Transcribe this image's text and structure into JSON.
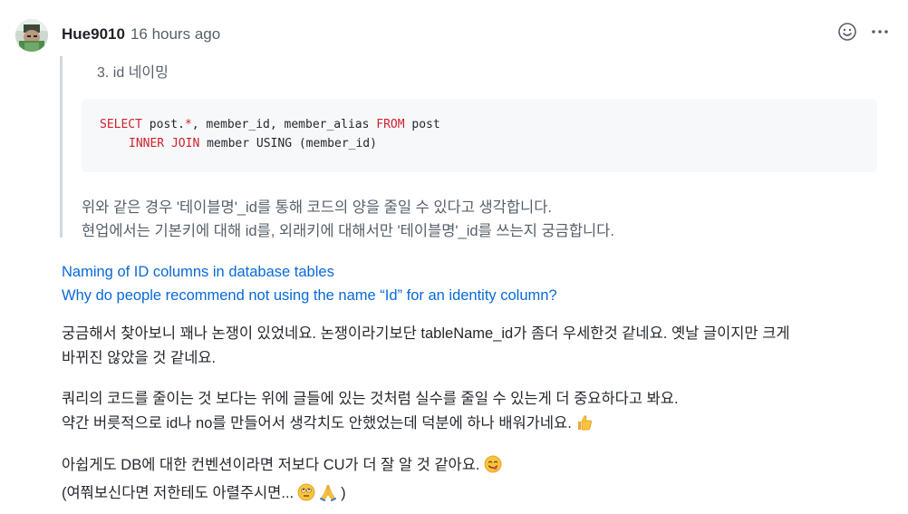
{
  "comment": {
    "author": "Hue9010",
    "timestamp": "16 hours ago",
    "quote": {
      "heading": "3. id 네이밍",
      "code": {
        "line1": {
          "kw1": "SELECT",
          "text1": " post.",
          "star": "*",
          "text2": ", member_id, member_alias ",
          "kw2": "FROM",
          "text3": " post"
        },
        "line2": {
          "kw1": "INNER",
          "sp": " ",
          "kw2": "JOIN",
          "text1": " member USING (member_id)"
        }
      },
      "text_line1": "위와 같은 경우 '테이블명'_id를 통해 코드의 양을 줄일 수 있다고 생각합니다.",
      "text_line2": "현업에서는 기본키에 대해 id를, 외래키에 대해서만 '테이블명'_id를 쓰는지 궁금합니다."
    },
    "links": [
      "Naming of ID columns in database tables",
      "Why do people recommend not using the name “Id” for an identity column?"
    ],
    "paragraphs": {
      "p1_line1": "궁금해서 찾아보니 꽤나 논쟁이 있었네요. 논쟁이라기보단 tableName_id가 좀더 우세한것 같네요. 옛날 글이지만 크게",
      "p1_line2": "바뀌진 않았을 것 같네요.",
      "p2_line1": "쿼리의 코드를 줄이는 것 보다는 위에 글들에 있는 것처럼 실수를 줄일 수 있는게 더 중요하다고 봐요.",
      "p2_line2": "약간 버릇적으로 id나 no를 만들어서 생각치도 안했었는데 덕분에 하나 배워가네요.",
      "p3_line1": "아쉽게도 DB에 대한 컨벤션이라면 저보다 CU가 더 잘 알 것 같아요.",
      "p3_line2_a": "(여쭤보신다면 저한테도 아렬주시면...",
      "p3_line2_b": ")"
    },
    "icons": {
      "reaction": "smiley-icon",
      "menu": "kebab-horizontal-icon",
      "thumbs_up": "thumbs-up-emoji",
      "yum": "yum-emoji",
      "rolling_eyes": "rolling-eyes-emoji",
      "pray": "folded-hands-emoji"
    },
    "colors": {
      "link": "#0969da",
      "keyword": "#cf222e",
      "muted": "#57606a",
      "quote_border": "#d0d7de",
      "code_bg": "#f6f8fa"
    }
  }
}
